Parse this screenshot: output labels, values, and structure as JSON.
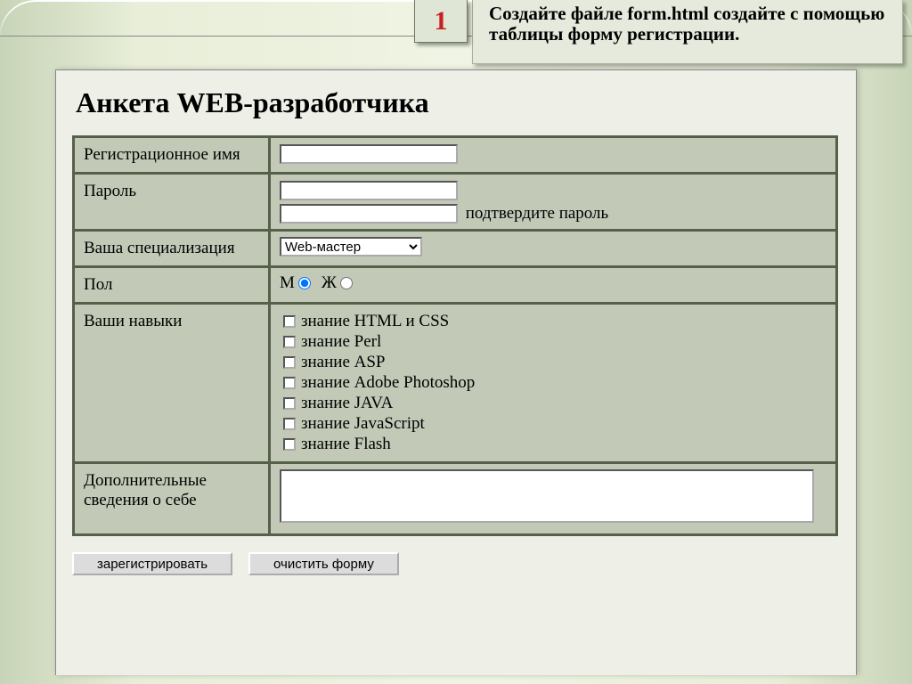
{
  "task": {
    "number": "1",
    "text": "Создайте файле form.html создайте с помощью таблицы форму регистрации."
  },
  "form": {
    "title": "Анкета WEB-разработчика",
    "rows": {
      "reg_name": {
        "label": "Регистрационное имя",
        "value": ""
      },
      "password": {
        "label": "Пароль",
        "value": "",
        "confirm_label": "подтвердите пароль"
      },
      "specialization": {
        "label": "Ваша специализация",
        "selected": "Web-мастер"
      },
      "gender": {
        "label": "Пол",
        "option_m": "М",
        "option_f": "Ж"
      },
      "skills": {
        "label": "Ваши навыки",
        "items": [
          "знание HTML и CSS",
          "знание Perl",
          "знание ASP",
          "знание Adobe Photoshop",
          "знание JAVA",
          "знание JavaScript",
          "знание Flash"
        ]
      },
      "additional": {
        "label": "Дополнительные сведения о себе",
        "value": ""
      }
    },
    "buttons": {
      "register": "зарегистрировать",
      "clear": "очистить форму"
    }
  }
}
